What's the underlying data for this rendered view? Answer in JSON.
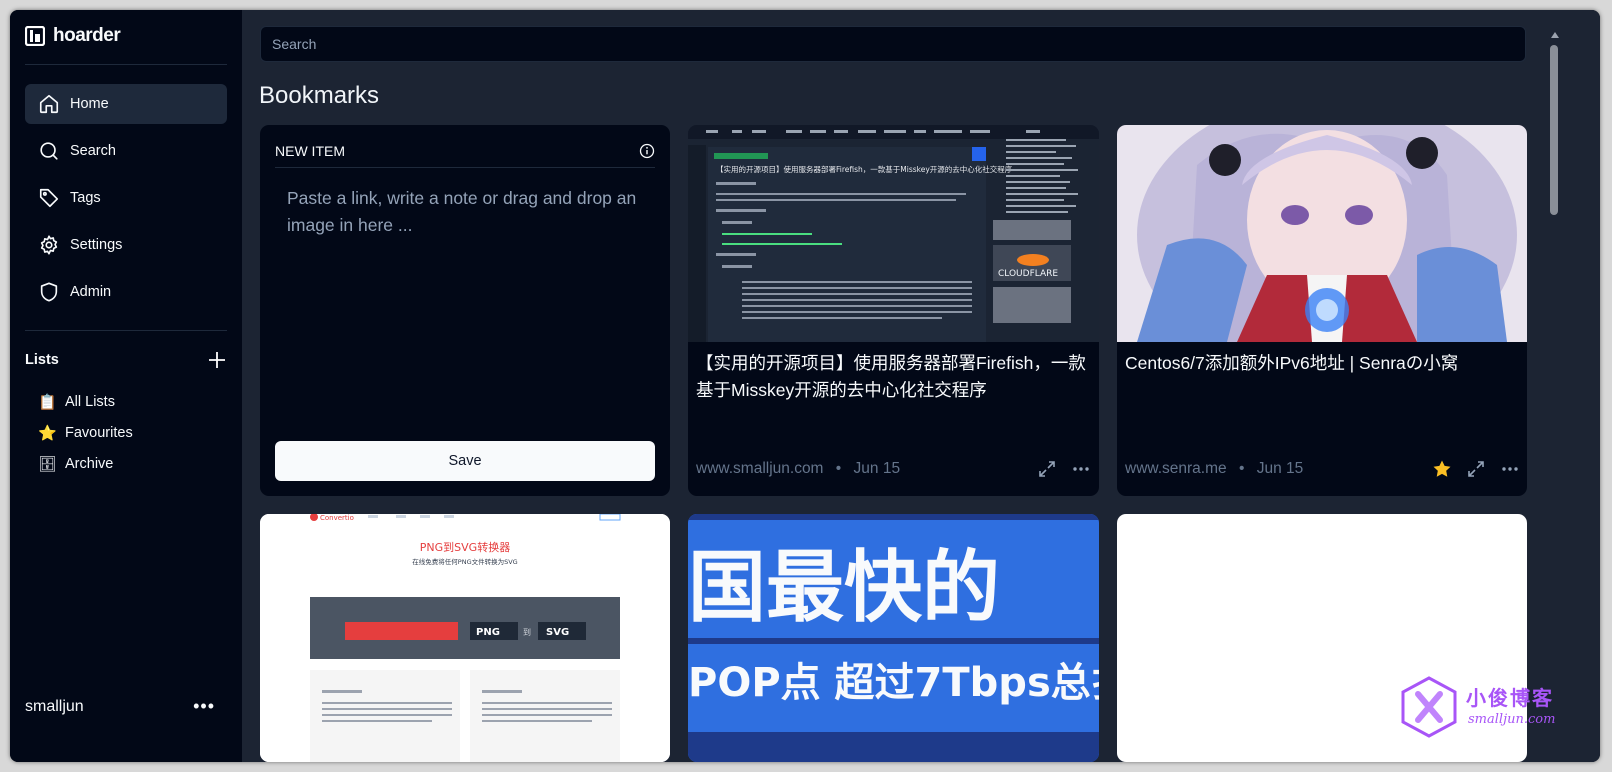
{
  "app": {
    "name": "hoarder"
  },
  "nav": [
    {
      "label": "Home",
      "icon": "home-icon",
      "active": true
    },
    {
      "label": "Search",
      "icon": "search-icon"
    },
    {
      "label": "Tags",
      "icon": "tag-icon"
    },
    {
      "label": "Settings",
      "icon": "gear-icon"
    },
    {
      "label": "Admin",
      "icon": "shield-icon"
    }
  ],
  "lists": {
    "title": "Lists",
    "items": [
      {
        "label": "All Lists",
        "emoji": "📋"
      },
      {
        "label": "Favourites",
        "emoji": "⭐"
      },
      {
        "label": "Archive",
        "emoji": "🗄"
      }
    ]
  },
  "user": {
    "name": "smalljun",
    "more": "•••"
  },
  "search": {
    "placeholder": "Search"
  },
  "page": {
    "title": "Bookmarks"
  },
  "new_item": {
    "title": "NEW ITEM",
    "placeholder": "Paste a link, write a note or drag and drop an image in here ...",
    "save_label": "Save"
  },
  "bookmarks": [
    {
      "title": "【实用的开源项目】使用服务器部署Firefish，一款基于Misskey开源的去中心化社交程序",
      "domain": "www.smalljun.com",
      "date": "Jun 15",
      "favourite": false,
      "thumb": {
        "heading": "【实用的开源项目】使用服务器部署Firefish，一款基于Misskey开源的去中心化社交程序",
        "sidebar_logo": "CLOUDFLARE"
      }
    },
    {
      "title": "Centos6/7添加额外IPv6地址 | Senraの小窝",
      "domain": "www.senra.me",
      "date": "Jun 15",
      "favourite": true
    }
  ],
  "row2": [
    {
      "thumb_title": "PNG到SVG转换器",
      "thumb_sub": "在线免费将任何PNG文件转换为SVG",
      "brand": "Convertio",
      "from": "PNG",
      "to": "SVG",
      "to_word": "到"
    },
    {
      "text_line1": "国最快的",
      "text_line2": "POP点 超过7Tbps总扌"
    },
    {}
  ],
  "watermark": {
    "text": "小俊博客",
    "url": "smalljun.com"
  },
  "colors": {
    "bg": "#1c2433",
    "sidebar": "#020817",
    "card": "#020817",
    "star": "#fbbf24"
  }
}
